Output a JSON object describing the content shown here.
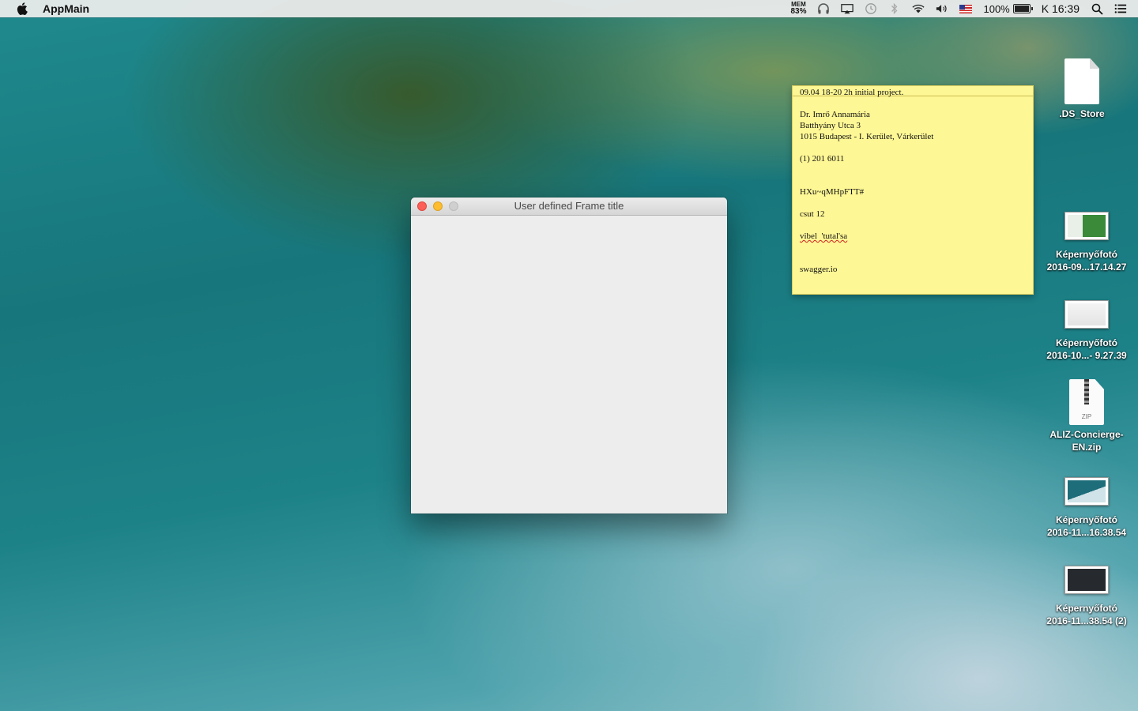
{
  "menubar": {
    "app_name": "AppMain",
    "mem_label": "MEM",
    "mem_value": "83%",
    "battery_percent": "100%",
    "clock": "K 16:39",
    "icons": [
      "apple-icon",
      "mem-monitor-icon",
      "headphones-icon",
      "airplay-icon",
      "time-machine-icon",
      "bluetooth-icon",
      "wifi-icon",
      "volume-icon",
      "us-flag-icon",
      "battery-icon",
      "spotlight-icon",
      "notification-center-icon"
    ]
  },
  "window": {
    "title": "User defined Frame title"
  },
  "sticky": {
    "lines": [
      "09.04 18-20 2h initial project.",
      "",
      "Dr. Imrő Annamária",
      "Batthyány Utca 3",
      "1015 Budapest - I. Kerület, Várkerület",
      "",
      "(1) 201 6011",
      "",
      "",
      "HXu~qMHpFTT#",
      "",
      "csut 12",
      "",
      "vibel  'tutal'sa",
      "",
      "",
      "swagger.io"
    ]
  },
  "desktop": {
    "items": [
      {
        "label_1": ".DS_Store",
        "label_2": ""
      },
      {
        "label_1": "Képernyőfotó",
        "label_2": "2016-09...17.14.27"
      },
      {
        "label_1": "Képernyőfotó",
        "label_2": "2016-10...- 9.27.39"
      },
      {
        "label_1": "ALIZ-Concierge-",
        "label_2": "EN.zip",
        "zip_tag": "ZIP"
      },
      {
        "label_1": "Képernyőfotó",
        "label_2": "2016-11...16.38.54"
      },
      {
        "label_1": "Képernyőfotó",
        "label_2": "2016-11...38.54 (2)"
      }
    ]
  }
}
